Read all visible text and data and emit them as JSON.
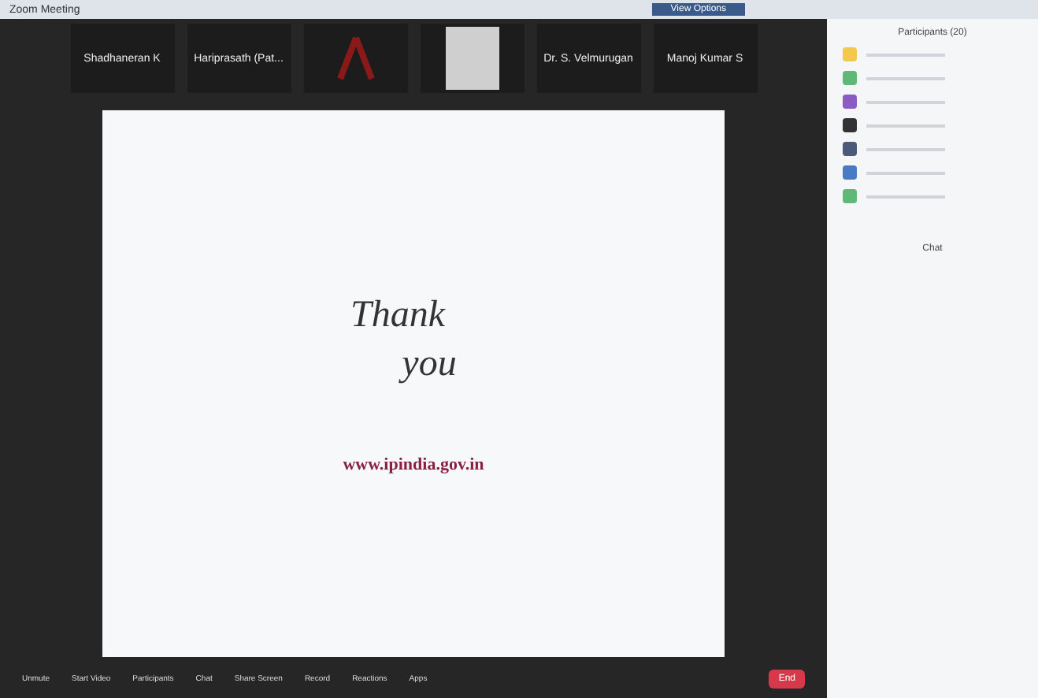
{
  "window": {
    "title": "Zoom Meeting",
    "banner": "View Options"
  },
  "video_strip": {
    "tiles": [
      {
        "name": "Shadhaneran K",
        "kind": "name"
      },
      {
        "name": "Hariprasath (Pat...",
        "kind": "name"
      },
      {
        "kind": "logo"
      },
      {
        "kind": "photo"
      },
      {
        "name": "Dr. S. Velmurugan",
        "kind": "name"
      },
      {
        "name": "Manoj Kumar S",
        "kind": "name"
      }
    ]
  },
  "slide": {
    "heading_1": "Thank",
    "heading_2": "you",
    "url": "www.ipindia.gov.in"
  },
  "toolbar": {
    "buttons": [
      "Unmute",
      "Start Video",
      "Participants",
      "Chat",
      "Share Screen",
      "Record",
      "Reactions",
      "Apps"
    ],
    "end": "End"
  },
  "participants": {
    "title": "Participants (20)",
    "items": [
      {
        "color": "#f2c94c"
      },
      {
        "color": "#5fb878"
      },
      {
        "color": "#8a5cc4"
      },
      {
        "color": "#333333"
      },
      {
        "color": "#4a5a78"
      },
      {
        "color": "#4a7ac4"
      },
      {
        "color": "#5fb878"
      }
    ]
  },
  "chat": {
    "title": "Chat"
  }
}
